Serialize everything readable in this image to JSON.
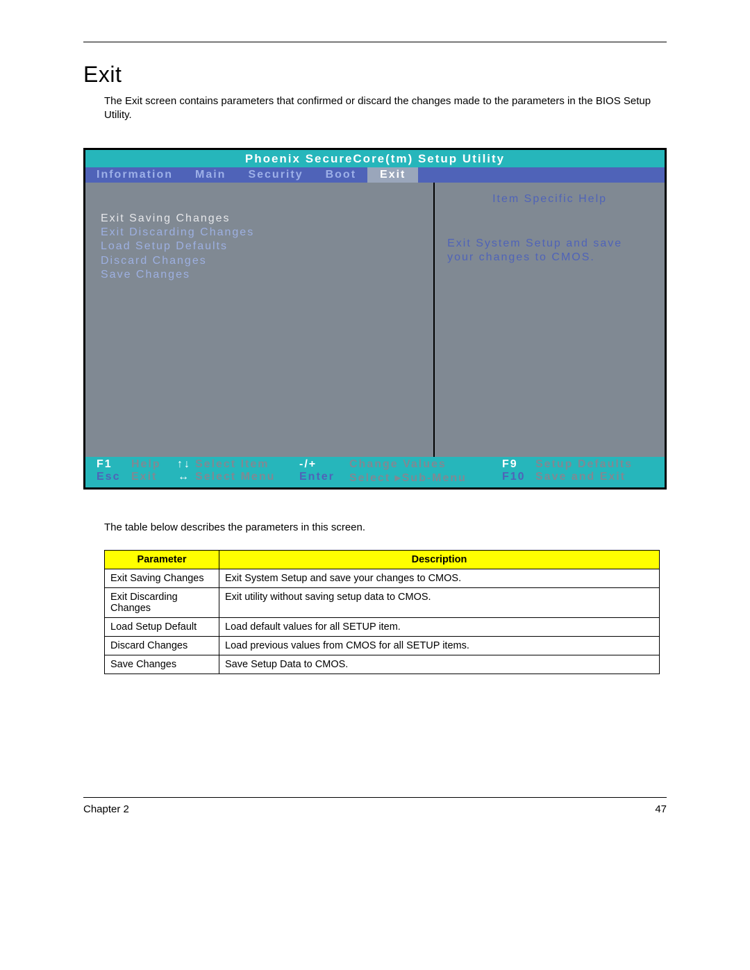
{
  "heading": "Exit",
  "intro": "The Exit screen contains parameters that confirmed or discard the changes made to the parameters in the BIOS Setup Utility.",
  "bios": {
    "title": "Phoenix SecureCore(tm) Setup Utility",
    "tabs": [
      "Information",
      "Main",
      "Security",
      "Boot",
      "Exit"
    ],
    "active_tab": "Exit",
    "menu_items": [
      "Exit Saving Changes",
      "Exit Discarding Changes",
      "Load Setup Defaults",
      "Discard Changes",
      "Save Changes"
    ],
    "selected_index": 0,
    "help_title": "Item Specific Help",
    "help_body": "Exit System Setup and save your changes to CMOS.",
    "footer": {
      "row1": {
        "k1": "F1",
        "a1": "Help",
        "arr": "↑↓",
        "a2": "Select Item",
        "k2": "-/+",
        "a3": "Change Values",
        "k3": "F9",
        "a4": "Setup Defaults"
      },
      "row2": {
        "k1": "Esc",
        "a1": "Exit",
        "arr": "↔",
        "a2": "Select Menu",
        "k2": "Enter",
        "a3": "Select  ▸Sub-Menu",
        "k3": "F10",
        "a4": "Save and Exit"
      }
    }
  },
  "mid_intro": "The table below describes the parameters in this screen.",
  "ptable": {
    "headers": [
      "Parameter",
      "Description"
    ],
    "rows": [
      [
        "Exit Saving Changes",
        "Exit System Setup and save your changes to CMOS."
      ],
      [
        "Exit Discarding Changes",
        "Exit utility without saving setup data to CMOS."
      ],
      [
        "Load Setup Default",
        "Load default values for all SETUP item."
      ],
      [
        "Discard Changes",
        "Load previous values from CMOS for all SETUP items."
      ],
      [
        "Save Changes",
        "Save Setup Data to CMOS."
      ]
    ]
  },
  "footer": {
    "chapter": "Chapter 2",
    "page": "47"
  }
}
